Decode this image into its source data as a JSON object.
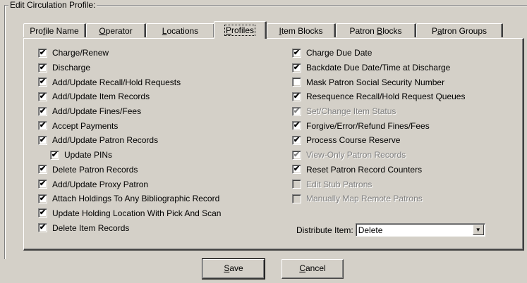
{
  "group_title": "Edit  Circulation Profile:",
  "tabs": [
    {
      "pre": "Pro",
      "acc": "f",
      "post": "ile Name"
    },
    {
      "pre": "",
      "acc": "O",
      "post": "perator"
    },
    {
      "pre": "",
      "acc": "L",
      "post": "ocations"
    },
    {
      "pre": "",
      "acc": "P",
      "post": "rofiles"
    },
    {
      "pre": "",
      "acc": "I",
      "post": "tem Blocks"
    },
    {
      "pre": "Patron ",
      "acc": "B",
      "post": "locks"
    },
    {
      "pre": "P",
      "acc": "a",
      "post": "tron Groups"
    }
  ],
  "active_tab": "Profiles",
  "left": [
    {
      "label": "Charge/Renew",
      "checked": "✔"
    },
    {
      "label": "Discharge",
      "checked": "✔"
    },
    {
      "label": "Add/Update Recall/Hold Requests",
      "checked": "✔"
    },
    {
      "label": "Add/Update Item Records",
      "checked": "✔"
    },
    {
      "label": "Add/Update Fines/Fees",
      "checked": "✔"
    },
    {
      "label": "Accept Payments",
      "checked": "✔"
    },
    {
      "label": "Add/Update Patron Records",
      "checked": "✔"
    },
    {
      "label": "Update PINs",
      "checked": "✔"
    },
    {
      "label": "Delete Patron Records",
      "checked": "✔"
    },
    {
      "label": "Add/Update Proxy Patron",
      "checked": "✔"
    },
    {
      "label": "Attach Holdings To Any Bibliographic Record",
      "checked": "✔"
    },
    {
      "label": "Update Holding Location With Pick And Scan",
      "checked": "✔"
    },
    {
      "label": "Delete Item Records",
      "checked": "✔"
    }
  ],
  "right": [
    {
      "label": "Charge Due Date",
      "checked": "✔"
    },
    {
      "label": "Backdate Due Date/Time at Discharge",
      "checked": "✔"
    },
    {
      "label": "Mask Patron Social Security Number",
      "checked": ""
    },
    {
      "label": "Resequence Recall/Hold Request Queues",
      "checked": "✔"
    },
    {
      "label": "Set/Change Item Status",
      "checked": "✔"
    },
    {
      "label": "Forgive/Error/Refund Fines/Fees",
      "checked": "✔"
    },
    {
      "label": "Process Course Reserve",
      "checked": "✔"
    },
    {
      "label": "View-Only Patron Records",
      "checked": "✔"
    },
    {
      "label": "Reset Patron Record Counters",
      "checked": "✔"
    },
    {
      "label": "Edit Stub Patrons",
      "checked": ""
    },
    {
      "label": "Manually Map Remote Patrons",
      "checked": ""
    }
  ],
  "distribute": {
    "label": "Distribute Item:",
    "value": "Delete"
  },
  "buttons": {
    "save": {
      "acc": "S",
      "post": "ave"
    },
    "cancel": {
      "acc": "C",
      "post": "ancel"
    }
  }
}
